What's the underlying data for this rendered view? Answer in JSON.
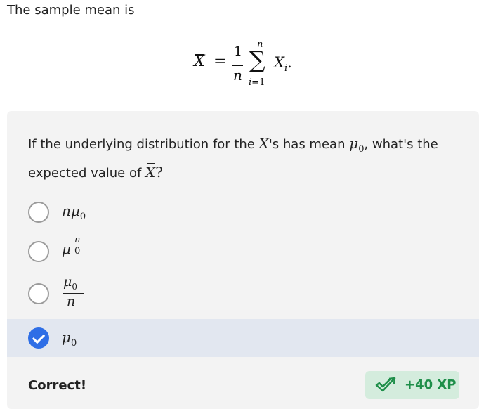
{
  "intro_text": "The sample mean is",
  "formula": {
    "lhs": "X",
    "equals": "=",
    "numerator": "1",
    "denominator": "n",
    "sum_upper": "n",
    "sum_symbol": "∑",
    "sum_lower_var": "i",
    "sum_lower_rest": "=1",
    "term": "X",
    "term_sub": "i",
    "period": "."
  },
  "question": {
    "part1": "If the underlying distribution for the ",
    "var": "X",
    "part2": "'s has mean ",
    "mu": "μ",
    "mu_sub": "0",
    "part3": ", what's the expected value of ",
    "var2": "X",
    "qmark": "?"
  },
  "options": [
    {
      "prefix": "n",
      "mu": "μ",
      "sub": "0",
      "selected": false
    },
    {
      "mu": "μ",
      "sup": "n",
      "sub": "0",
      "selected": false
    },
    {
      "mu": "μ",
      "sub": "0",
      "den": "n",
      "selected": false
    },
    {
      "mu": "μ",
      "sub": "0",
      "selected": true
    }
  ],
  "feedback_text": "Correct!",
  "xp_text": "+40 XP",
  "xp_icon": "check-arrow-icon",
  "colors": {
    "selected_radio": "#2e6ee6",
    "selected_row": "#e2e7f0",
    "xp_badge_bg": "#d4ecdd",
    "xp_text": "#1f8f4a"
  }
}
